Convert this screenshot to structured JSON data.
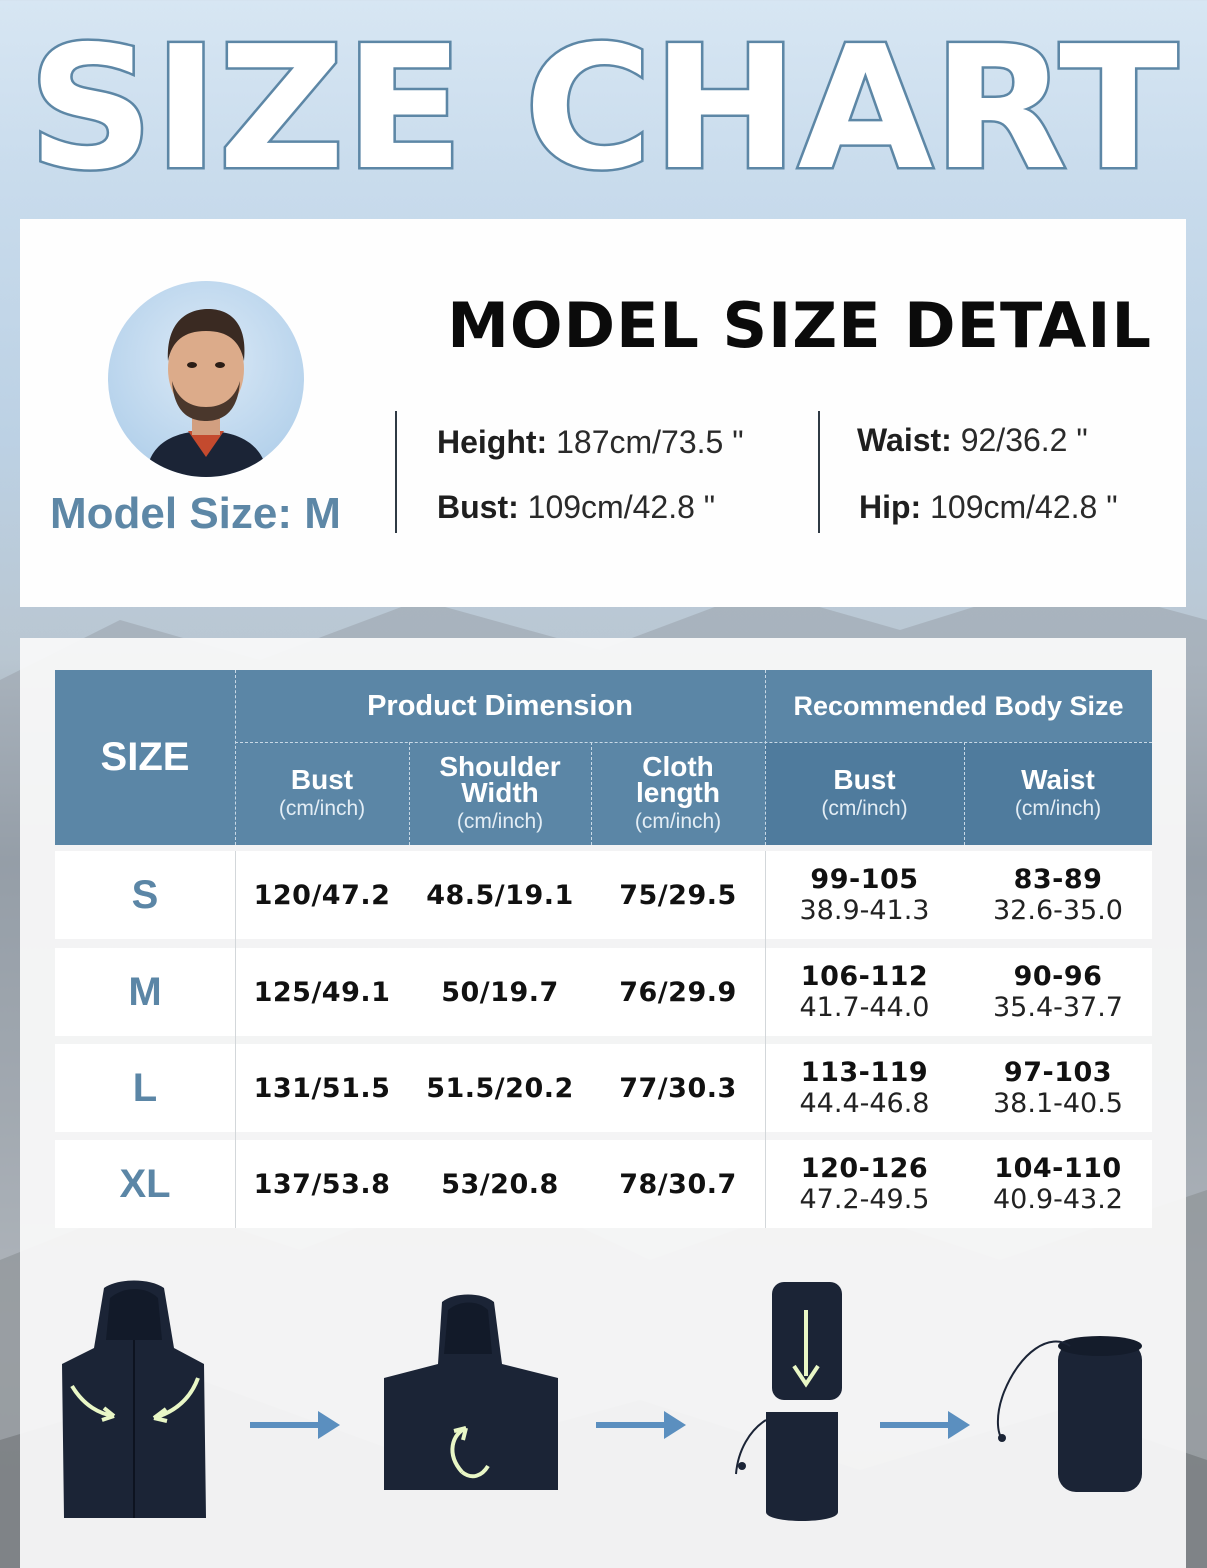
{
  "title": "SIZE CHART",
  "model": {
    "heading": "MODEL SIZE DETAIL",
    "size_label": "Model Size: M",
    "measurements": [
      {
        "label": "Height:",
        "value": "187cm/73.5 \""
      },
      {
        "label": "Bust:",
        "value": "109cm/42.8 \""
      },
      {
        "label": "Waist:",
        "value": "92/36.2 \""
      },
      {
        "label": "Hip:",
        "value": "109cm/42.8 \""
      }
    ]
  },
  "table": {
    "size_header": "SIZE",
    "groups": [
      "Product Dimension",
      "Recommended Body Size"
    ],
    "columns": [
      {
        "title_lines": [
          "Bust"
        ],
        "unit": "(cm/inch)"
      },
      {
        "title_lines": [
          "Shoulder",
          "Width"
        ],
        "unit": "(cm/inch)"
      },
      {
        "title_lines": [
          "Cloth",
          "length"
        ],
        "unit": "(cm/inch)"
      },
      {
        "title_lines": [
          "Bust"
        ],
        "unit": "(cm/inch)"
      },
      {
        "title_lines": [
          "Waist"
        ],
        "unit": "(cm/inch)"
      }
    ],
    "rows": [
      {
        "size": "S",
        "bust": "120/47.2",
        "shoulder": "48.5/19.1",
        "length": "75/29.5",
        "rec_bust": [
          "99-105",
          "38.9-41.3"
        ],
        "rec_waist": [
          "83-89",
          "32.6-35.0"
        ]
      },
      {
        "size": "M",
        "bust": "125/49.1",
        "shoulder": "50/19.7",
        "length": "76/29.9",
        "rec_bust": [
          "106-112",
          "41.7-44.0"
        ],
        "rec_waist": [
          "90-96",
          "35.4-37.7"
        ]
      },
      {
        "size": "L",
        "bust": "131/51.5",
        "shoulder": "51.5/20.2",
        "length": "77/30.3",
        "rec_bust": [
          "113-119",
          "44.4-46.8"
        ],
        "rec_waist": [
          "97-103",
          "38.1-40.5"
        ]
      },
      {
        "size": "XL",
        "bust": "137/53.8",
        "shoulder": "53/20.8",
        "length": "78/30.7",
        "rec_bust": [
          "120-126",
          "47.2-49.5"
        ],
        "rec_waist": [
          "104-110",
          "40.9-43.2"
        ]
      }
    ]
  },
  "colors": {
    "header_blue": "#5b86a6",
    "accent_text": "#5d87a6",
    "jacket_navy": "#1b2436",
    "arrow_blue": "#5b8fbf",
    "glow_arrow": "#e9f7c6"
  },
  "steps_icons": [
    "jacket-fold-icon",
    "arrow-right-icon",
    "jacket-roll-icon",
    "arrow-right-icon",
    "jacket-stuff-icon",
    "arrow-right-icon",
    "stuff-sack-icon"
  ]
}
